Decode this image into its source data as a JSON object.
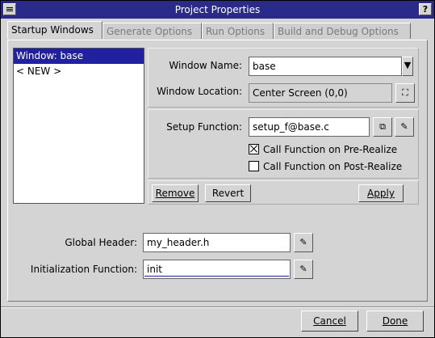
{
  "window": {
    "title": "Project Properties",
    "help_label": "?"
  },
  "tabs": [
    {
      "label": "Startup Windows",
      "active": true
    },
    {
      "label": "Generate Options",
      "active": false
    },
    {
      "label": "Run Options",
      "active": false
    },
    {
      "label": "Build and Debug Options",
      "active": false
    }
  ],
  "window_list": {
    "items": [
      "Window: base",
      "< NEW >"
    ],
    "selected_index": 0
  },
  "window_name": {
    "label": "Window Name:",
    "value": "base"
  },
  "window_location": {
    "label": "Window Location:",
    "value": "Center Screen (0,0)"
  },
  "setup_function": {
    "label": "Setup Function:",
    "value": "setup_f@base.c"
  },
  "checkboxes": {
    "pre_realize": {
      "label": "Call Function on Pre-Realize",
      "checked": true
    },
    "post_realize": {
      "label": "Call Function on Post-Realize",
      "checked": false
    }
  },
  "buttons": {
    "remove": "Remove",
    "revert": "Revert",
    "apply": "Apply",
    "cancel": "Cancel",
    "done": "Done"
  },
  "global_header": {
    "label": "Global Header:",
    "value": "my_header.h"
  },
  "init_function": {
    "label": "Initialization Function:",
    "value": "init"
  },
  "icons": {
    "dropdown": "arrow-down-icon",
    "location": "location-picker-icon",
    "copy": "copy-icon",
    "edit": "pencil-icon"
  },
  "colors": {
    "title_bar": "#2a2a8a",
    "selection": "#2020a0",
    "face": "#d4d4d4"
  }
}
